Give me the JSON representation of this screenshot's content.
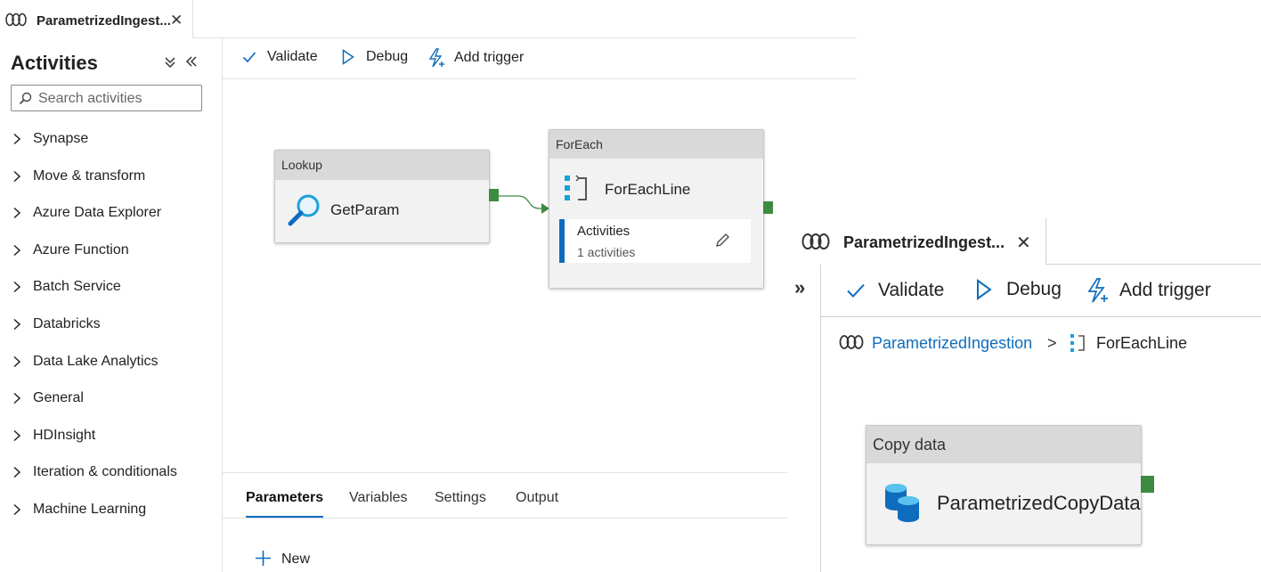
{
  "left_tab": {
    "title": "ParametrizedIngest...",
    "icon": "pipeline-icon",
    "close": "✕"
  },
  "sidebar": {
    "title": "Activities",
    "search_placeholder": "Search activities",
    "items": [
      {
        "label": "Synapse"
      },
      {
        "label": "Move & transform"
      },
      {
        "label": "Azure Data Explorer"
      },
      {
        "label": "Azure Function"
      },
      {
        "label": "Batch Service"
      },
      {
        "label": "Databricks"
      },
      {
        "label": "Data Lake Analytics"
      },
      {
        "label": "General"
      },
      {
        "label": "HDInsight"
      },
      {
        "label": "Iteration & conditionals"
      },
      {
        "label": "Machine Learning"
      }
    ]
  },
  "toolbar": {
    "validate": "Validate",
    "debug": "Debug",
    "add_trigger": "Add trigger"
  },
  "canvas": {
    "lookup": {
      "type": "Lookup",
      "name": "GetParam"
    },
    "foreach": {
      "type": "ForEach",
      "name": "ForEachLine",
      "inner_label": "Activities",
      "inner_count": "1 activities"
    }
  },
  "bottom_panel": {
    "tabs": [
      {
        "label": "Parameters"
      },
      {
        "label": "Variables"
      },
      {
        "label": "Settings"
      },
      {
        "label": "Output"
      }
    ],
    "new_label": "New"
  },
  "right_panel": {
    "tab_title": "ParametrizedIngest...",
    "close": "✕",
    "expand": "»",
    "toolbar": {
      "validate": "Validate",
      "debug": "Debug",
      "add_trigger": "Add trigger"
    },
    "breadcrumb": {
      "pipeline": "ParametrizedIngestion",
      "separator": ">",
      "current": "ForEachLine"
    },
    "copy": {
      "type": "Copy data",
      "name": "ParametrizedCopyData"
    }
  },
  "colors": {
    "accent": "#0f6cbd",
    "handle": "#3d8b40",
    "header_gray": "#d9d9d9"
  }
}
